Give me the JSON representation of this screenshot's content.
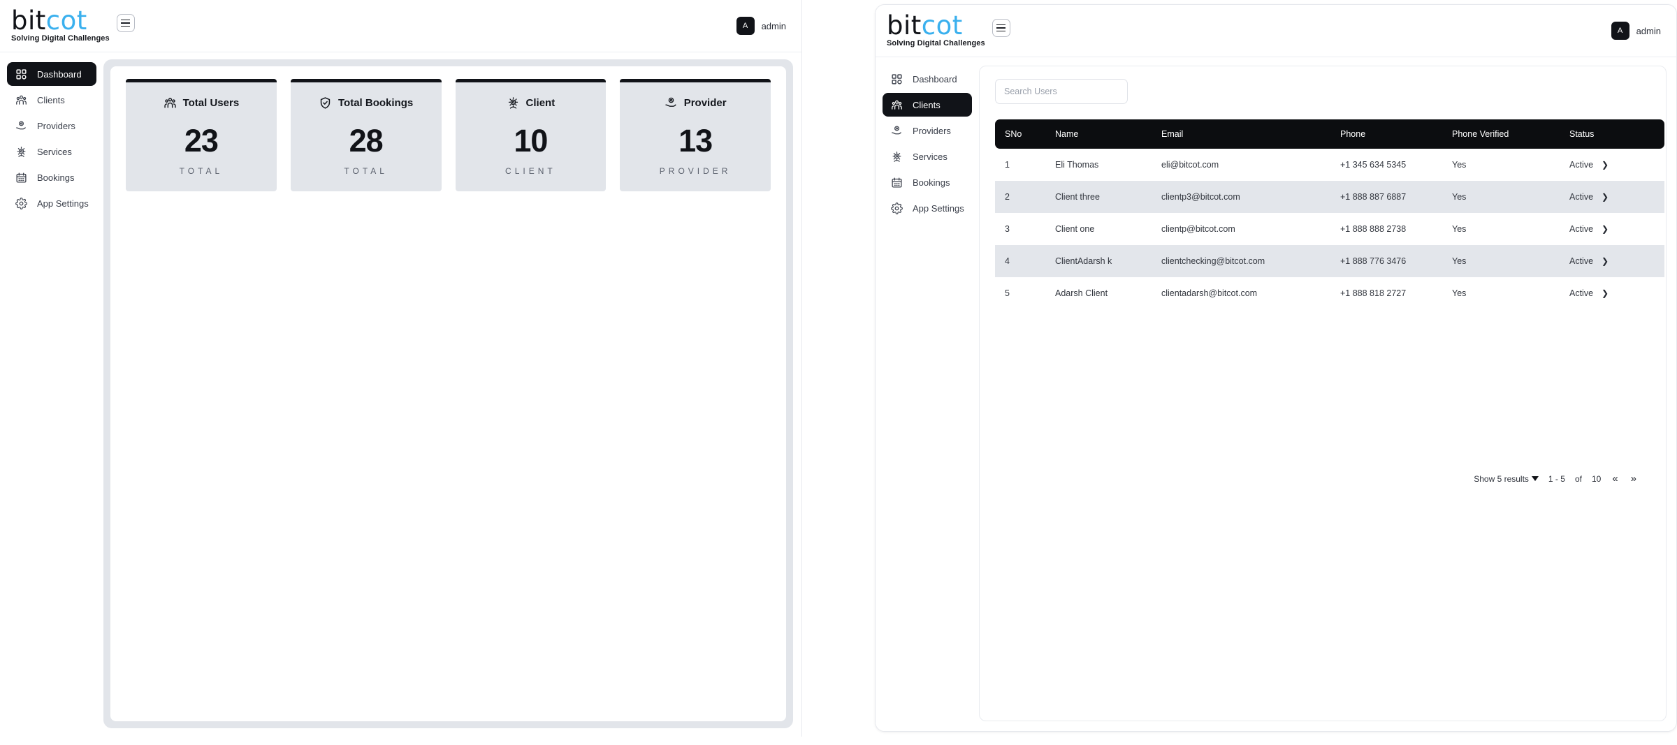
{
  "brand": {
    "word_a": "bit",
    "word_b": "cot",
    "tagline": "Solving Digital Challenges"
  },
  "topbar": {
    "avatar_initial": "A",
    "user_name": "admin",
    "menu_icon": "hamburger-icon"
  },
  "sidebar": {
    "items": [
      {
        "label": "Dashboard",
        "icon": "grid-icon"
      },
      {
        "label": "Clients",
        "icon": "people-group-icon"
      },
      {
        "label": "Providers",
        "icon": "provider-hand-icon"
      },
      {
        "label": "Services",
        "icon": "gear-people-icon"
      },
      {
        "label": "Bookings",
        "icon": "calendar-icon"
      },
      {
        "label": "App Settings",
        "icon": "gear-icon"
      }
    ],
    "left_active": "Dashboard",
    "right_active": "Clients"
  },
  "dashboard": {
    "cards": [
      {
        "title": "Total Users",
        "icon": "people-group-icon",
        "value": "23",
        "label": "TOTAL"
      },
      {
        "title": "Total Bookings",
        "icon": "shield-check-icon",
        "value": "28",
        "label": "TOTAL"
      },
      {
        "title": "Client",
        "icon": "gear-people-icon",
        "value": "10",
        "label": "CLIENT"
      },
      {
        "title": "Provider",
        "icon": "provider-hand-icon",
        "value": "13",
        "label": "PROVIDER"
      }
    ]
  },
  "users": {
    "search": {
      "placeholder": "Search Users",
      "value": ""
    },
    "columns": [
      "SNo",
      "Name",
      "Email",
      "Phone",
      "Phone Verified",
      "Status"
    ],
    "rows": [
      {
        "sno": "1",
        "name": "Eli Thomas",
        "email": "eli@bitcot.com",
        "phone": "+1 345 634 5345",
        "verified": "Yes",
        "status": "Active"
      },
      {
        "sno": "2",
        "name": "Client three",
        "email": "clientp3@bitcot.com",
        "phone": "+1 888 887 6887",
        "verified": "Yes",
        "status": "Active"
      },
      {
        "sno": "3",
        "name": "Client one",
        "email": "clientp@bitcot.com",
        "phone": "+1 888 888 2738",
        "verified": "Yes",
        "status": "Active"
      },
      {
        "sno": "4",
        "name": "ClientAdarsh k",
        "email": "clientchecking@bitcot.com",
        "phone": "+1 888 776 3476",
        "verified": "Yes",
        "status": "Active"
      },
      {
        "sno": "5",
        "name": "Adarsh Client",
        "email": "clientadarsh@bitcot.com",
        "phone": "+1 888 818 2727",
        "verified": "Yes",
        "status": "Active"
      }
    ],
    "pagination": {
      "show_results": "Show 5 results",
      "range": "1 - 5",
      "of": "of",
      "total": "10",
      "prev": "«",
      "next": "»"
    }
  },
  "colors": {
    "accent": "#3ab0ee",
    "dark": "#111318",
    "panel": "#e2e5ea"
  }
}
